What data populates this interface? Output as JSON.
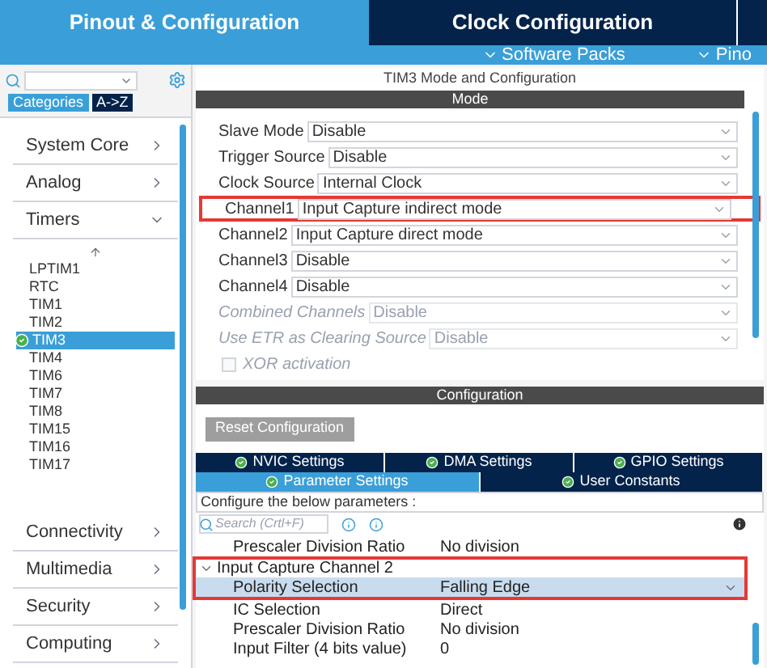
{
  "top_tabs": [
    {
      "label": "Pinout & Configuration",
      "selected": true
    },
    {
      "label": "Clock Configuration",
      "selected": false
    }
  ],
  "sub_menu": [
    "Software Packs",
    "Pino"
  ],
  "sidebar": {
    "view_tabs": [
      {
        "label": "Categories",
        "selected": true
      },
      {
        "label": "A->Z",
        "selected": false
      }
    ],
    "categories_top": [
      {
        "label": "System Core",
        "expanded": false
      },
      {
        "label": "Analog",
        "expanded": false
      },
      {
        "label": "Timers",
        "expanded": true
      }
    ],
    "timers": [
      {
        "label": "LPTIM1",
        "selected": false
      },
      {
        "label": "RTC",
        "selected": false
      },
      {
        "label": "TIM1",
        "selected": false
      },
      {
        "label": "TIM2",
        "selected": false
      },
      {
        "label": "TIM3",
        "selected": true
      },
      {
        "label": "TIM4",
        "selected": false
      },
      {
        "label": "TIM6",
        "selected": false
      },
      {
        "label": "TIM7",
        "selected": false
      },
      {
        "label": "TIM8",
        "selected": false
      },
      {
        "label": "TIM15",
        "selected": false
      },
      {
        "label": "TIM16",
        "selected": false
      },
      {
        "label": "TIM17",
        "selected": false
      }
    ],
    "categories_bottom": [
      {
        "label": "Connectivity",
        "expanded": false
      },
      {
        "label": "Multimedia",
        "expanded": false
      },
      {
        "label": "Security",
        "expanded": false
      },
      {
        "label": "Computing",
        "expanded": false
      }
    ]
  },
  "panel": {
    "title": "TIM3 Mode and Configuration",
    "mode_header": "Mode",
    "mode_rows": [
      {
        "kind": "select",
        "label": "Slave Mode",
        "value": "Disable",
        "disabled": false
      },
      {
        "kind": "select",
        "label": "Trigger Source",
        "value": "Disable",
        "disabled": false
      },
      {
        "kind": "select",
        "label": "Clock Source",
        "value": "Internal Clock",
        "disabled": false
      },
      {
        "kind": "select",
        "label": "Channel1",
        "value": "Input Capture indirect mode",
        "disabled": false,
        "highlighted": true
      },
      {
        "kind": "select",
        "label": "Channel2",
        "value": "Input Capture direct mode",
        "disabled": false
      },
      {
        "kind": "select",
        "label": "Channel3",
        "value": "Disable",
        "disabled": false
      },
      {
        "kind": "select",
        "label": "Channel4",
        "value": "Disable",
        "disabled": false
      },
      {
        "kind": "select",
        "label": "Combined Channels",
        "value": "Disable",
        "disabled": true
      },
      {
        "kind": "select",
        "label": "Use ETR as Clearing Source",
        "value": "Disable",
        "disabled": true
      },
      {
        "kind": "checkbox",
        "label": "XOR activation",
        "checked": false,
        "disabled": true
      }
    ],
    "config_header": "Configuration",
    "reset_button": "Reset Configuration",
    "config_tabs": [
      [
        {
          "label": "NVIC Settings",
          "selected": false
        },
        {
          "label": "DMA Settings",
          "selected": false
        },
        {
          "label": "GPIO Settings",
          "selected": false
        }
      ],
      [
        {
          "label": "Parameter Settings",
          "selected": true
        },
        {
          "label": "User Constants",
          "selected": false
        }
      ]
    ],
    "configure_hint": "Configure the below parameters :",
    "search": {
      "placeholder": "Search (Crtl+F)"
    },
    "params": [
      {
        "kind": "param",
        "label": "Prescaler Division Ratio",
        "value": "No division",
        "selected": false
      },
      {
        "kind": "group",
        "label": "Input Capture Channel 2",
        "expanded": true,
        "highlighted": true,
        "children": [
          {
            "kind": "param",
            "label": "Polarity Selection",
            "value": "Falling Edge",
            "selected": true
          },
          {
            "kind": "param",
            "label": "IC Selection",
            "value": "Direct",
            "selected": false
          },
          {
            "kind": "param",
            "label": "Prescaler Division Ratio",
            "value": "No division",
            "selected": false
          },
          {
            "kind": "param",
            "label": "Input Filter (4 bits value)",
            "value": "0",
            "selected": false
          }
        ]
      }
    ]
  }
}
